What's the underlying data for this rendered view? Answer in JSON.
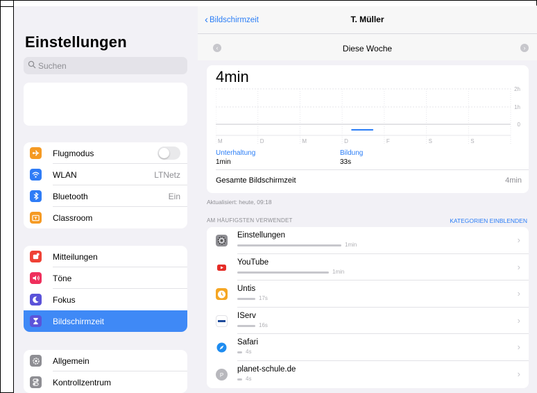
{
  "sidebar": {
    "title": "Einstellungen",
    "search_placeholder": "Suchen",
    "group1": [
      {
        "label": "Flugmodus",
        "value": "",
        "icon": "airplane-icon",
        "color": "#f59a23"
      },
      {
        "label": "WLAN",
        "value": "LTNetz",
        "icon": "wifi-icon",
        "color": "#2f7cf6"
      },
      {
        "label": "Bluetooth",
        "value": "Ein",
        "icon": "bluetooth-icon",
        "color": "#2f7cf6"
      },
      {
        "label": "Classroom",
        "value": "",
        "icon": "classroom-icon",
        "color": "#f59a23"
      }
    ],
    "group2": [
      {
        "label": "Mitteilungen",
        "icon": "notifications-icon",
        "color": "#ef4135"
      },
      {
        "label": "Töne",
        "icon": "sounds-icon",
        "color": "#ef2f5c"
      },
      {
        "label": "Fokus",
        "icon": "moon-icon",
        "color": "#5b53d9"
      },
      {
        "label": "Bildschirmzeit",
        "icon": "hourglass-icon",
        "color": "#5b53d9"
      }
    ],
    "group3": [
      {
        "label": "Allgemein",
        "icon": "gear-icon",
        "color": "#8e8e93"
      },
      {
        "label": "Kontrollzentrum",
        "icon": "control-center-icon",
        "color": "#8e8e93"
      }
    ]
  },
  "main": {
    "back_label": "Bildschirmzeit",
    "nav_title": "T. Müller",
    "week_label": "Diese Woche",
    "total": "4min",
    "y_ticks": [
      "2h",
      "1h",
      "0"
    ],
    "day_labels": [
      "M",
      "D",
      "M",
      "D",
      "F",
      "S",
      "S"
    ],
    "categories": [
      {
        "name": "Unterhaltung",
        "value": "1min"
      },
      {
        "name": "Bildung",
        "value": "33s"
      }
    ],
    "summary_label": "Gesamte Bildschirmzeit",
    "summary_value": "4min",
    "updated": "Aktualisiert: heute, 09:18",
    "section_title": "AM HÄUFIGSTEN VERWENDET",
    "section_link": "KATEGORIEN EINBLENDEN",
    "apps": [
      {
        "name": "Einstellungen",
        "time": "1min",
        "bar": 0.68,
        "icon": "settings-app-icon"
      },
      {
        "name": "YouTube",
        "time": "1min",
        "bar": 0.6,
        "icon": "youtube-icon"
      },
      {
        "name": "Untis",
        "time": "17s",
        "bar": 0.12,
        "icon": "untis-icon"
      },
      {
        "name": "IServ",
        "time": "16s",
        "bar": 0.12,
        "icon": "iserv-icon"
      },
      {
        "name": "Safari",
        "time": "4s",
        "bar": 0.03,
        "icon": "safari-icon"
      },
      {
        "name": "planet-schule.de",
        "time": "4s",
        "bar": 0.03,
        "icon": "website-icon"
      }
    ]
  },
  "colors": {
    "accent": "#2a7df6",
    "selected": "#3f89f6"
  }
}
